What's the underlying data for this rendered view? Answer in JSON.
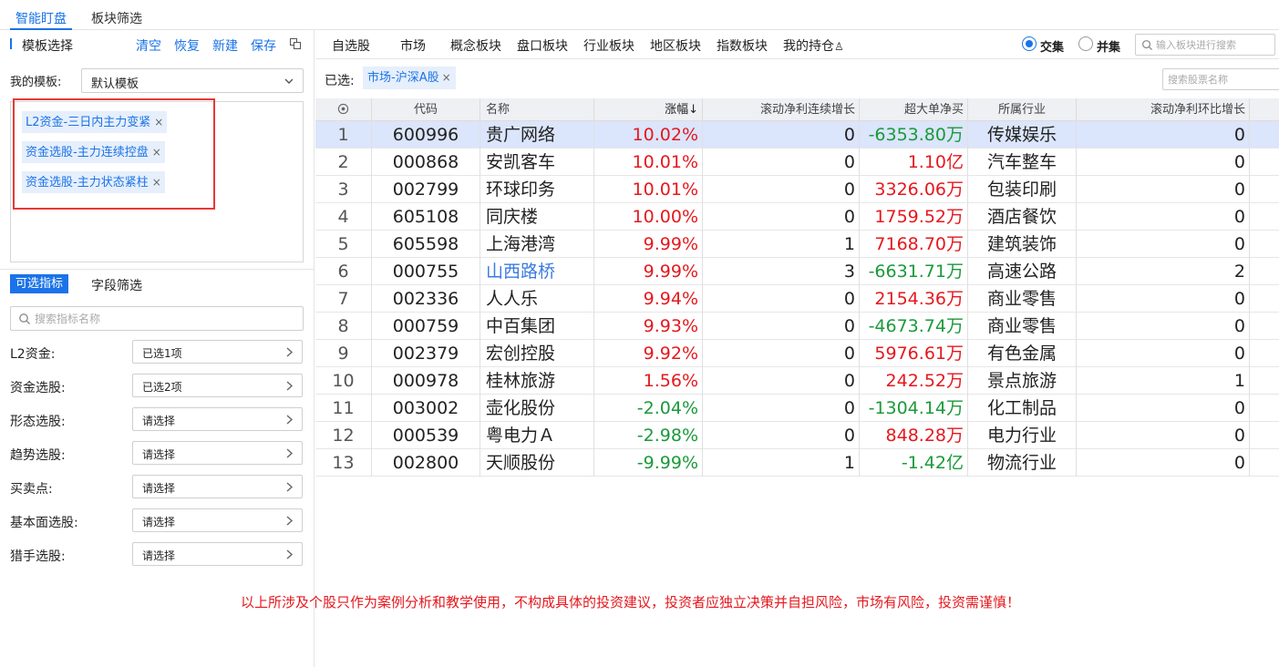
{
  "top_tabs": {
    "smart": "智能盯盘",
    "sector": "板块筛选"
  },
  "template": {
    "title": "模板选择",
    "actions": {
      "clear": "清空",
      "restore": "恢复",
      "new": "新建",
      "save": "保存"
    },
    "my_label": "我的模板:",
    "selected": "默认模板",
    "tags": [
      "L2资金-三日内主力变紧",
      "资金选股-主力连续控盘",
      "资金选股-主力状态紧柱"
    ]
  },
  "indicator_tabs": {
    "active": "可选指标",
    "other": "字段筛选"
  },
  "indicator_search": {
    "placeholder": "搜索指标名称"
  },
  "filters": [
    {
      "label": "L2资金:",
      "value": "已选1项"
    },
    {
      "label": "资金选股:",
      "value": "已选2项"
    },
    {
      "label": "形态选股:",
      "value": "请选择"
    },
    {
      "label": "趋势选股:",
      "value": "请选择"
    },
    {
      "label": "买卖点:",
      "value": "请选择"
    },
    {
      "label": "基本面选股:",
      "value": "请选择"
    },
    {
      "label": "猎手选股:",
      "value": "请选择"
    }
  ],
  "market_tabs": [
    "自选股",
    "市场",
    "概念板块",
    "盘口板块",
    "行业板块",
    "地区板块",
    "指数板块",
    "我的持仓"
  ],
  "mode": {
    "intersection": "交集",
    "union": "并集"
  },
  "block_search": {
    "placeholder": "输入板块进行搜索"
  },
  "selected_bar": {
    "label": "已选:",
    "tag": "市场-沪深A股"
  },
  "stock_search": {
    "placeholder": "搜索股票名称"
  },
  "table": {
    "headers": [
      "代码",
      "名称",
      "涨幅↓",
      "滚动净利连续增长",
      "超大单净买",
      "所属行业",
      "滚动净利环比增长"
    ],
    "rows": [
      {
        "idx": "1",
        "code": "600996",
        "name": "贵广网络",
        "chg": "10.02%",
        "growth": "0",
        "bigbuy": "-6353.80万",
        "industry": "传媒娱乐",
        "qoq": "0"
      },
      {
        "idx": "2",
        "code": "000868",
        "name": "安凯客车",
        "chg": "10.01%",
        "growth": "0",
        "bigbuy": "1.10亿",
        "industry": "汽车整车",
        "qoq": "0"
      },
      {
        "idx": "3",
        "code": "002799",
        "name": "环球印务",
        "chg": "10.01%",
        "growth": "0",
        "bigbuy": "3326.06万",
        "industry": "包装印刷",
        "qoq": "0"
      },
      {
        "idx": "4",
        "code": "605108",
        "name": "同庆楼",
        "chg": "10.00%",
        "growth": "0",
        "bigbuy": "1759.52万",
        "industry": "酒店餐饮",
        "qoq": "0"
      },
      {
        "idx": "5",
        "code": "605598",
        "name": "上海港湾",
        "chg": "9.99%",
        "growth": "1",
        "bigbuy": "7168.70万",
        "industry": "建筑装饰",
        "qoq": "0"
      },
      {
        "idx": "6",
        "code": "000755",
        "name": "山西路桥",
        "chg": "9.99%",
        "growth": "3",
        "bigbuy": "-6631.71万",
        "industry": "高速公路",
        "qoq": "2"
      },
      {
        "idx": "7",
        "code": "002336",
        "name": "人人乐",
        "chg": "9.94%",
        "growth": "0",
        "bigbuy": "2154.36万",
        "industry": "商业零售",
        "qoq": "0"
      },
      {
        "idx": "8",
        "code": "000759",
        "name": "中百集团",
        "chg": "9.93%",
        "growth": "0",
        "bigbuy": "-4673.74万",
        "industry": "商业零售",
        "qoq": "0"
      },
      {
        "idx": "9",
        "code": "002379",
        "name": "宏创控股",
        "chg": "9.92%",
        "growth": "0",
        "bigbuy": "5976.61万",
        "industry": "有色金属",
        "qoq": "0"
      },
      {
        "idx": "10",
        "code": "000978",
        "name": "桂林旅游",
        "chg": "1.56%",
        "growth": "0",
        "bigbuy": "242.52万",
        "industry": "景点旅游",
        "qoq": "1"
      },
      {
        "idx": "11",
        "code": "003002",
        "name": "壶化股份",
        "chg": "-2.04%",
        "growth": "0",
        "bigbuy": "-1304.14万",
        "industry": "化工制品",
        "qoq": "0"
      },
      {
        "idx": "12",
        "code": "000539",
        "name": "粤电力Ａ",
        "chg": "-2.98%",
        "growth": "0",
        "bigbuy": "848.28万",
        "industry": "电力行业",
        "qoq": "0"
      },
      {
        "idx": "13",
        "code": "002800",
        "name": "天顺股份",
        "chg": "-9.99%",
        "growth": "1",
        "bigbuy": "-1.42亿",
        "industry": "物流行业",
        "qoq": "0"
      }
    ]
  },
  "disclaimer": "以上所涉及个股只作为案例分析和教学使用，不构成具体的投资建议，投资者应独立决策并自担风险，市场有风险，投资需谨慎！",
  "colors": {
    "accent": "#1a73e8",
    "up": "#e5181e",
    "down": "#1a9a3a",
    "highlight_row": "#dbe5fb"
  }
}
